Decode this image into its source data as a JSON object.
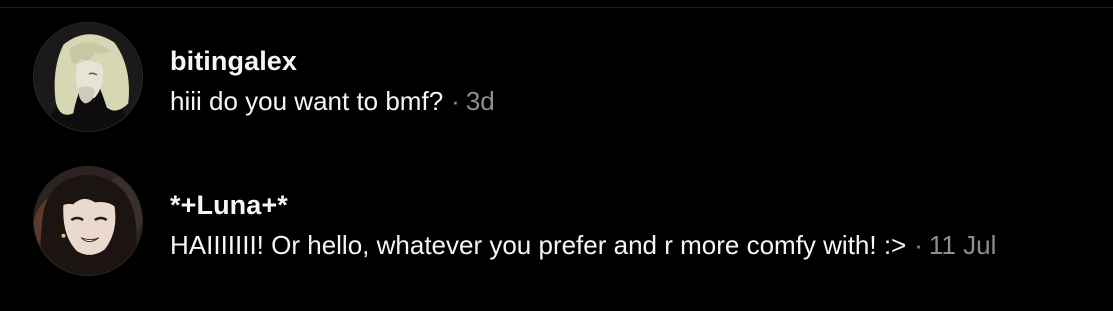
{
  "conversations": [
    {
      "username": "bitingalex",
      "message": "hiii do you want to bmf?",
      "separator": "·",
      "time": "3d",
      "avatar_icon": "avatar-blonde-character-icon"
    },
    {
      "username": "*+Luna+*",
      "message": "HAIIIIIII! Or hello, whatever you prefer and r more comfy with! :>",
      "separator": "·",
      "time": "11 Jul",
      "avatar_icon": "avatar-dark-haired-character-icon"
    }
  ],
  "colors": {
    "background": "#000000",
    "text_primary": "#f5f5f5",
    "text_secondary": "#8e8e8e"
  }
}
